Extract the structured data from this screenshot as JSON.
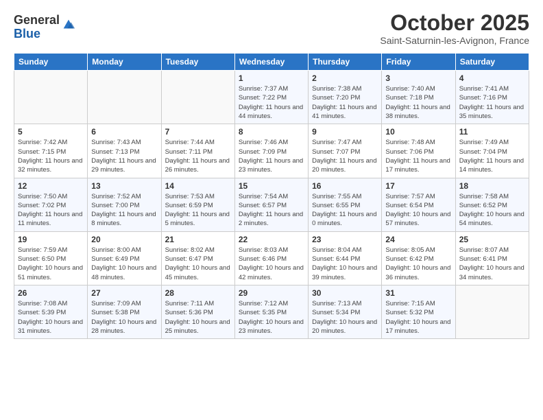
{
  "header": {
    "logo_general": "General",
    "logo_blue": "Blue",
    "title": "October 2025",
    "location": "Saint-Saturnin-les-Avignon, France"
  },
  "weekdays": [
    "Sunday",
    "Monday",
    "Tuesday",
    "Wednesday",
    "Thursday",
    "Friday",
    "Saturday"
  ],
  "weeks": [
    [
      {
        "day": "",
        "detail": ""
      },
      {
        "day": "",
        "detail": ""
      },
      {
        "day": "",
        "detail": ""
      },
      {
        "day": "1",
        "detail": "Sunrise: 7:37 AM\nSunset: 7:22 PM\nDaylight: 11 hours and 44 minutes."
      },
      {
        "day": "2",
        "detail": "Sunrise: 7:38 AM\nSunset: 7:20 PM\nDaylight: 11 hours and 41 minutes."
      },
      {
        "day": "3",
        "detail": "Sunrise: 7:40 AM\nSunset: 7:18 PM\nDaylight: 11 hours and 38 minutes."
      },
      {
        "day": "4",
        "detail": "Sunrise: 7:41 AM\nSunset: 7:16 PM\nDaylight: 11 hours and 35 minutes."
      }
    ],
    [
      {
        "day": "5",
        "detail": "Sunrise: 7:42 AM\nSunset: 7:15 PM\nDaylight: 11 hours and 32 minutes."
      },
      {
        "day": "6",
        "detail": "Sunrise: 7:43 AM\nSunset: 7:13 PM\nDaylight: 11 hours and 29 minutes."
      },
      {
        "day": "7",
        "detail": "Sunrise: 7:44 AM\nSunset: 7:11 PM\nDaylight: 11 hours and 26 minutes."
      },
      {
        "day": "8",
        "detail": "Sunrise: 7:46 AM\nSunset: 7:09 PM\nDaylight: 11 hours and 23 minutes."
      },
      {
        "day": "9",
        "detail": "Sunrise: 7:47 AM\nSunset: 7:07 PM\nDaylight: 11 hours and 20 minutes."
      },
      {
        "day": "10",
        "detail": "Sunrise: 7:48 AM\nSunset: 7:06 PM\nDaylight: 11 hours and 17 minutes."
      },
      {
        "day": "11",
        "detail": "Sunrise: 7:49 AM\nSunset: 7:04 PM\nDaylight: 11 hours and 14 minutes."
      }
    ],
    [
      {
        "day": "12",
        "detail": "Sunrise: 7:50 AM\nSunset: 7:02 PM\nDaylight: 11 hours and 11 minutes."
      },
      {
        "day": "13",
        "detail": "Sunrise: 7:52 AM\nSunset: 7:00 PM\nDaylight: 11 hours and 8 minutes."
      },
      {
        "day": "14",
        "detail": "Sunrise: 7:53 AM\nSunset: 6:59 PM\nDaylight: 11 hours and 5 minutes."
      },
      {
        "day": "15",
        "detail": "Sunrise: 7:54 AM\nSunset: 6:57 PM\nDaylight: 11 hours and 2 minutes."
      },
      {
        "day": "16",
        "detail": "Sunrise: 7:55 AM\nSunset: 6:55 PM\nDaylight: 11 hours and 0 minutes."
      },
      {
        "day": "17",
        "detail": "Sunrise: 7:57 AM\nSunset: 6:54 PM\nDaylight: 10 hours and 57 minutes."
      },
      {
        "day": "18",
        "detail": "Sunrise: 7:58 AM\nSunset: 6:52 PM\nDaylight: 10 hours and 54 minutes."
      }
    ],
    [
      {
        "day": "19",
        "detail": "Sunrise: 7:59 AM\nSunset: 6:50 PM\nDaylight: 10 hours and 51 minutes."
      },
      {
        "day": "20",
        "detail": "Sunrise: 8:00 AM\nSunset: 6:49 PM\nDaylight: 10 hours and 48 minutes."
      },
      {
        "day": "21",
        "detail": "Sunrise: 8:02 AM\nSunset: 6:47 PM\nDaylight: 10 hours and 45 minutes."
      },
      {
        "day": "22",
        "detail": "Sunrise: 8:03 AM\nSunset: 6:46 PM\nDaylight: 10 hours and 42 minutes."
      },
      {
        "day": "23",
        "detail": "Sunrise: 8:04 AM\nSunset: 6:44 PM\nDaylight: 10 hours and 39 minutes."
      },
      {
        "day": "24",
        "detail": "Sunrise: 8:05 AM\nSunset: 6:42 PM\nDaylight: 10 hours and 36 minutes."
      },
      {
        "day": "25",
        "detail": "Sunrise: 8:07 AM\nSunset: 6:41 PM\nDaylight: 10 hours and 34 minutes."
      }
    ],
    [
      {
        "day": "26",
        "detail": "Sunrise: 7:08 AM\nSunset: 5:39 PM\nDaylight: 10 hours and 31 minutes."
      },
      {
        "day": "27",
        "detail": "Sunrise: 7:09 AM\nSunset: 5:38 PM\nDaylight: 10 hours and 28 minutes."
      },
      {
        "day": "28",
        "detail": "Sunrise: 7:11 AM\nSunset: 5:36 PM\nDaylight: 10 hours and 25 minutes."
      },
      {
        "day": "29",
        "detail": "Sunrise: 7:12 AM\nSunset: 5:35 PM\nDaylight: 10 hours and 23 minutes."
      },
      {
        "day": "30",
        "detail": "Sunrise: 7:13 AM\nSunset: 5:34 PM\nDaylight: 10 hours and 20 minutes."
      },
      {
        "day": "31",
        "detail": "Sunrise: 7:15 AM\nSunset: 5:32 PM\nDaylight: 10 hours and 17 minutes."
      },
      {
        "day": "",
        "detail": ""
      }
    ]
  ]
}
